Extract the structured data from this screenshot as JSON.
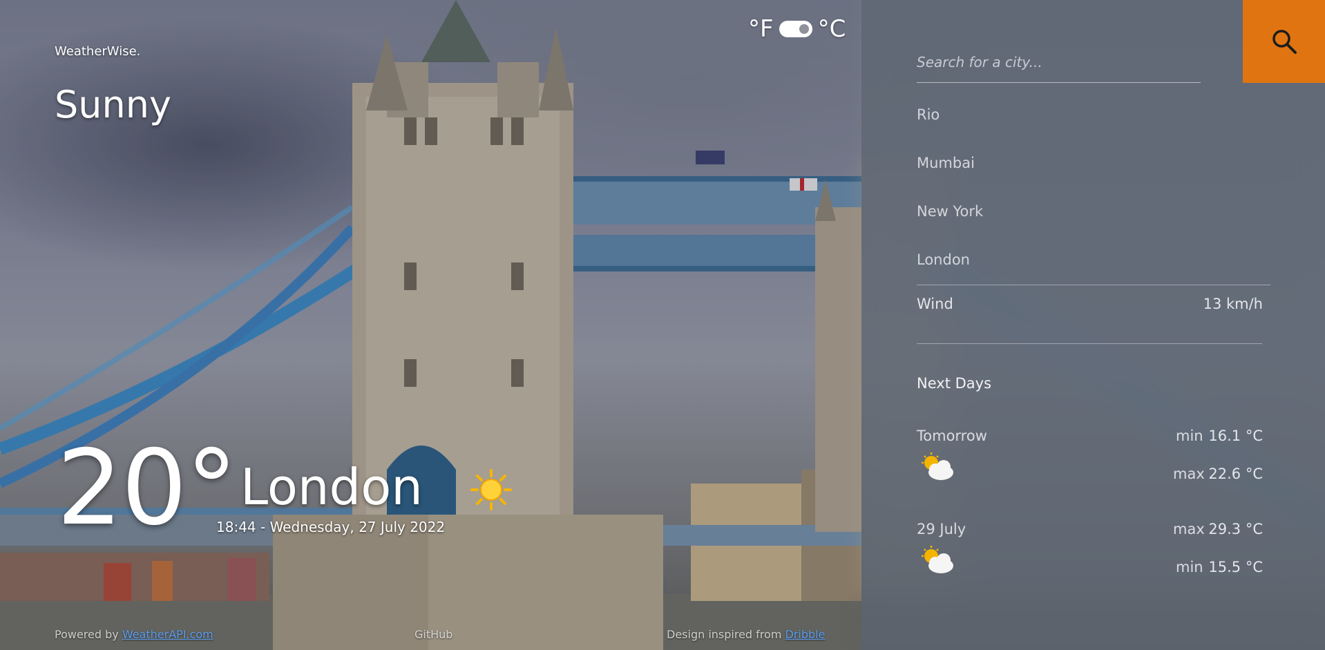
{
  "app": {
    "brand": "WeatherWise."
  },
  "current": {
    "condition": "Sunny",
    "temperature": "20°",
    "city": "London",
    "datetime": "18:44 - Wednesday, 27 July 2022",
    "icon": "sun-icon"
  },
  "units": {
    "fahrenheit": "°F",
    "celsius": "°C",
    "selected": "°C"
  },
  "search": {
    "placeholder": "Search for a city...",
    "value": ""
  },
  "cities": [
    "Rio",
    "Mumbai",
    "New York",
    "London"
  ],
  "details": {
    "wind_label": "Wind",
    "wind_value": "13 km/h"
  },
  "forecast": {
    "title": "Next Days",
    "days": [
      {
        "name": "Tomorrow",
        "top_label": "min",
        "top_value": "16.1 °C",
        "bottom_label": "max",
        "bottom_value": "22.6 °C",
        "icon": "partly-cloudy-icon"
      },
      {
        "name": "29 July",
        "top_label": "max",
        "top_value": "29.3 °C",
        "bottom_label": "min",
        "bottom_value": "15.5 °C",
        "icon": "partly-cloudy-icon"
      }
    ]
  },
  "footer": {
    "powered_prefix": "Powered by ",
    "powered_link": "WeatherAPI.com",
    "github": "GitHub",
    "inspired_prefix": "Design inspired from ",
    "inspired_link": "Dribble"
  },
  "colors": {
    "accent": "#e07410",
    "panel": "#5c6470",
    "link": "#5a9cf0"
  }
}
